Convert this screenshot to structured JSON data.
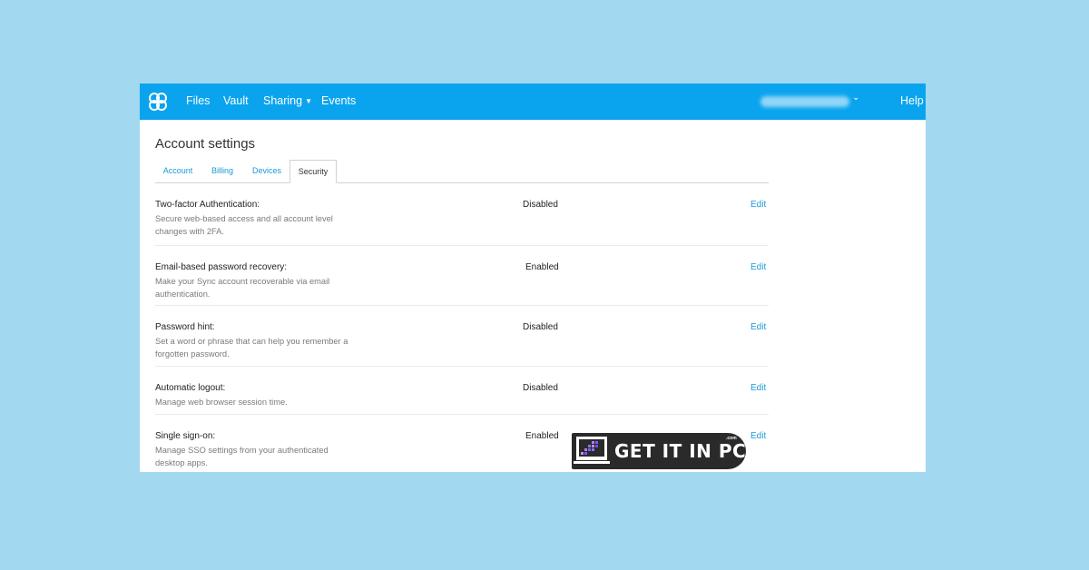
{
  "navbar": {
    "links": [
      "Files",
      "Vault",
      "Sharing",
      "Events"
    ],
    "user_blurred": "",
    "help": "Help",
    "accent": "#0aa4ee"
  },
  "page": {
    "title": "Account settings",
    "tabs": [
      "Account",
      "Billing",
      "Devices",
      "Security"
    ],
    "active_tab": "Security"
  },
  "settings": [
    {
      "title": "Two-factor Authentication:",
      "desc": "Secure web-based access and all account level changes with 2FA.",
      "status": "Disabled",
      "action": "Edit"
    },
    {
      "title": "Email-based password recovery:",
      "desc": "Make your Sync account recoverable via email authentication.",
      "status": "Enabled",
      "action": "Edit"
    },
    {
      "title": "Password hint:",
      "desc": "Set a word or phrase that can help you remember a forgotten password.",
      "status": "Disabled",
      "action": "Edit"
    },
    {
      "title": "Automatic logout:",
      "desc": "Manage web browser session time.",
      "status": "Disabled",
      "action": "Edit"
    },
    {
      "title": "Single sign-on:",
      "desc": "Manage SSO settings from your authenticated desktop apps.",
      "status": "Enabled",
      "action": "Edit"
    }
  ],
  "watermark": {
    "text": "GET IT IN PC",
    "suffix": ".com"
  }
}
